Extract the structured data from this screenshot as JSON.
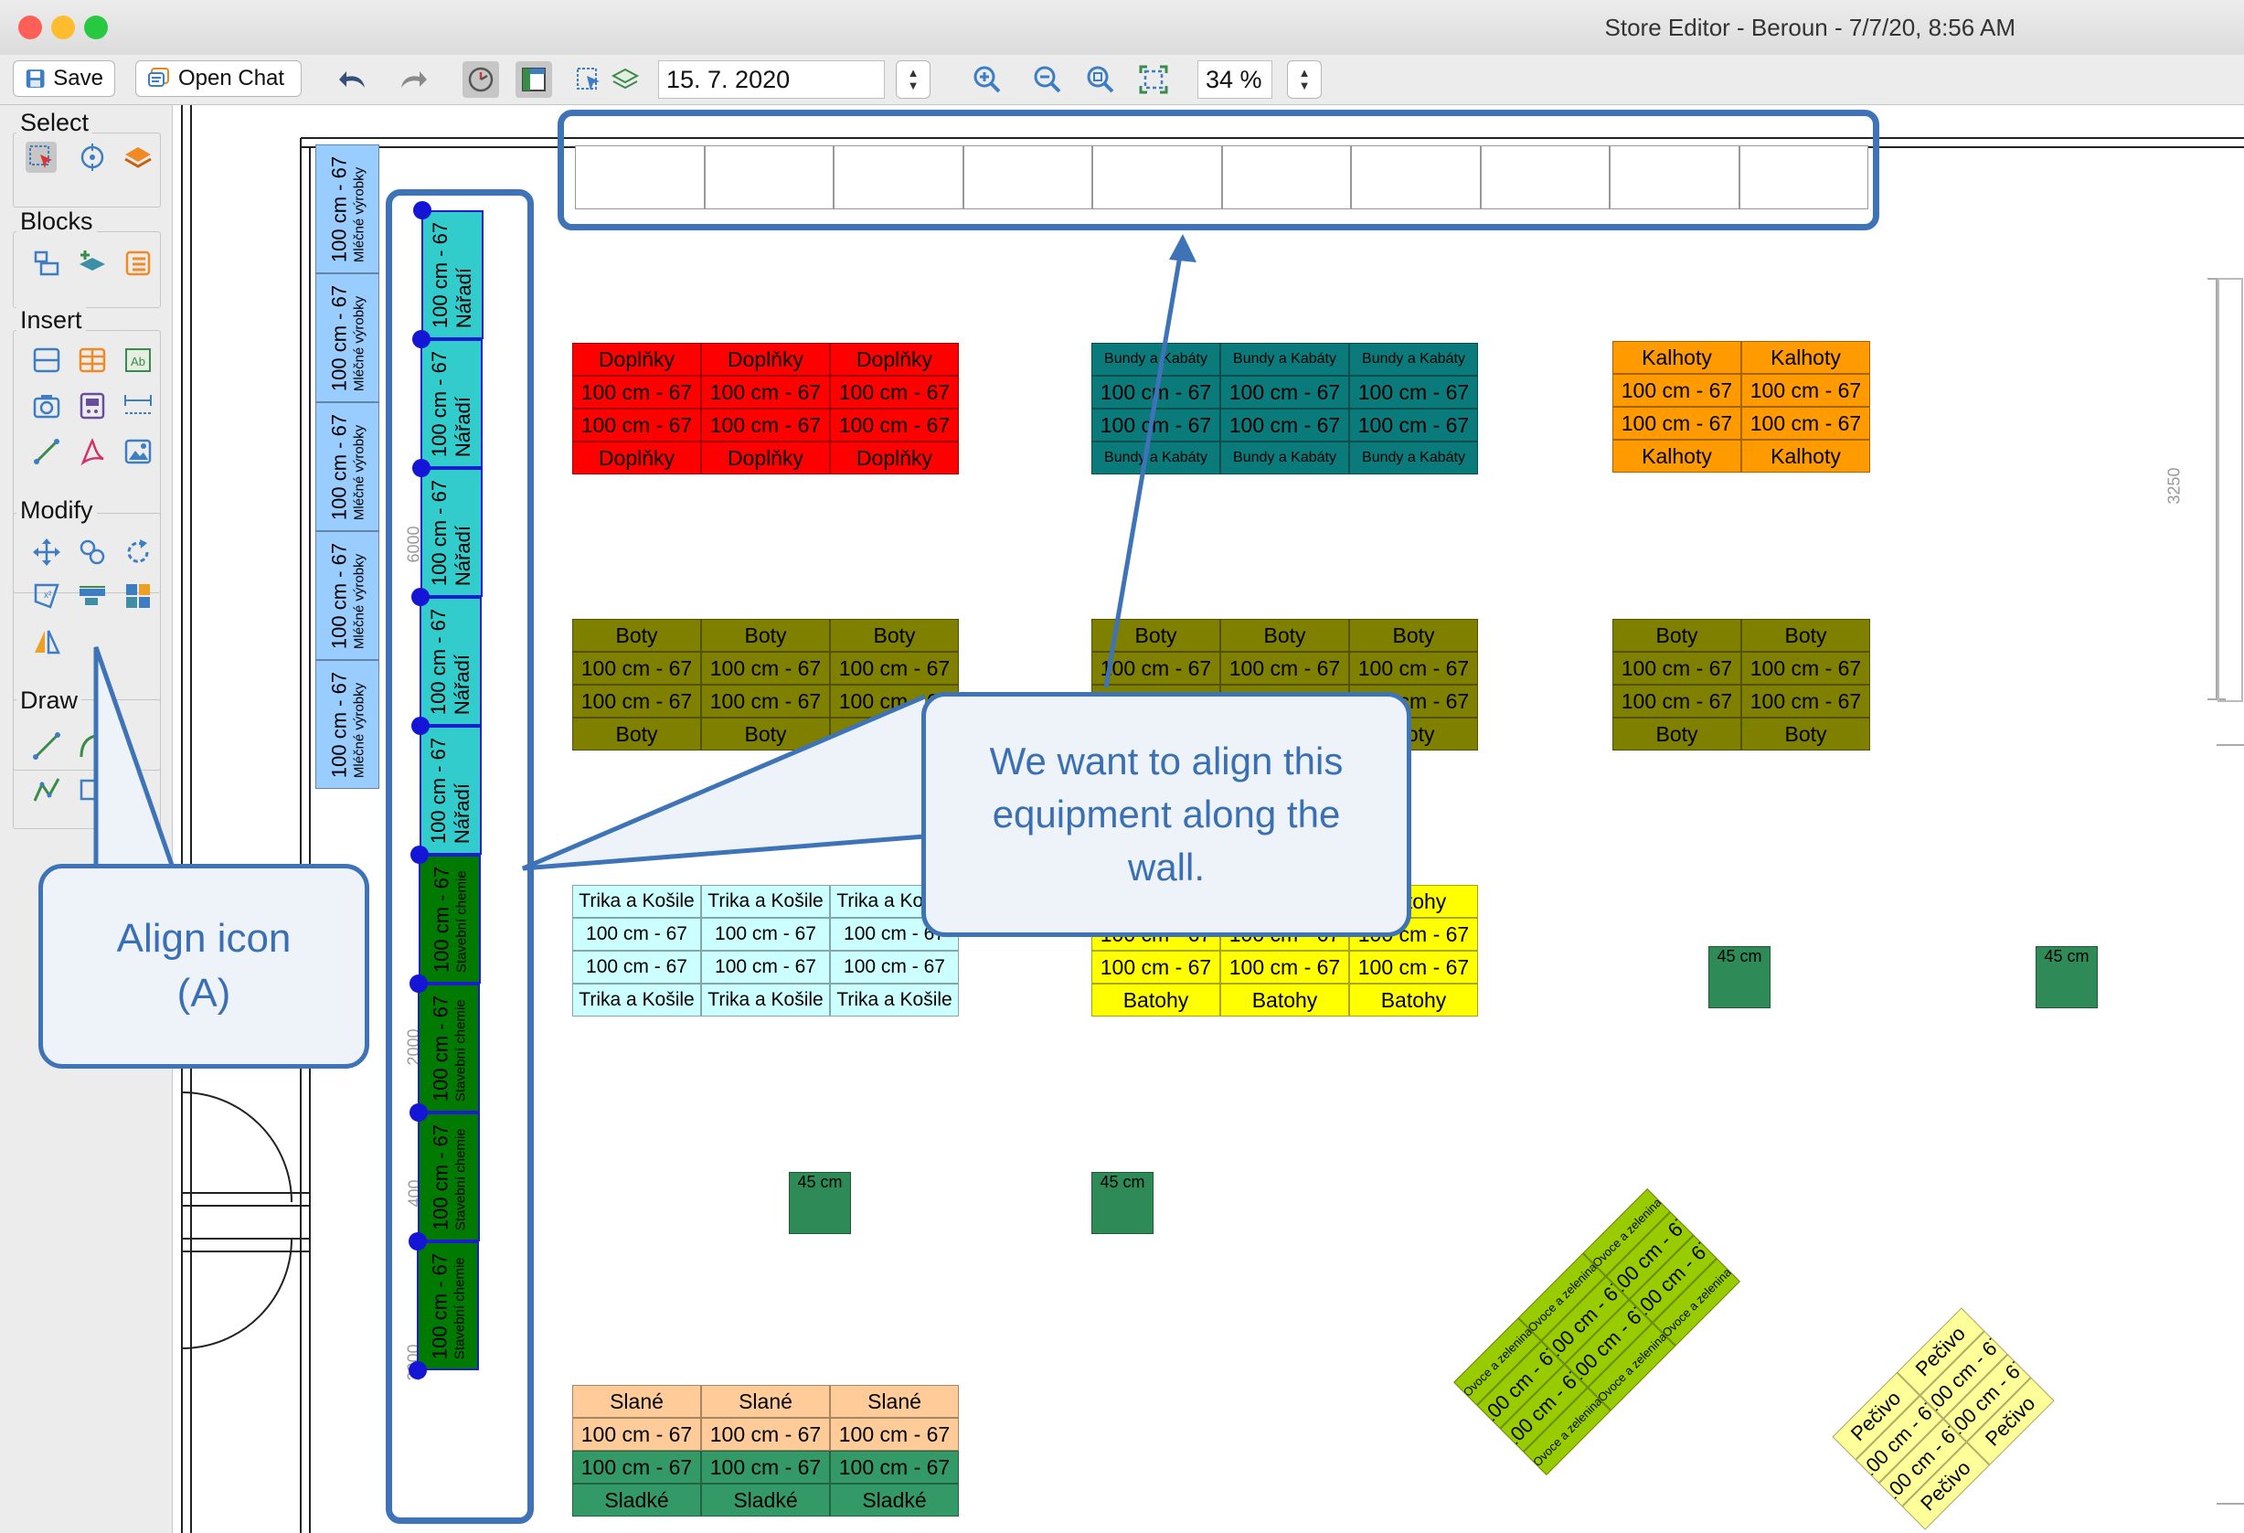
{
  "window": {
    "title": "Store Editor - Beroun - 7/7/20, 8:56 AM",
    "controls": {
      "close": "#fe5f57",
      "minimize": "#febc2e",
      "zoom": "#28c840"
    }
  },
  "toolbar": {
    "save_label": "Save",
    "open_chat_label": "Open Chat",
    "date_value": "15. 7. 2020",
    "zoom_value": "34 %",
    "icons": [
      "undo-icon",
      "redo-icon",
      "clock-icon",
      "floor-plan-icon",
      "select-layer-icon",
      "layers-icon",
      "zoom-in-icon",
      "zoom-out-icon",
      "zoom-reset-icon",
      "fit-icon"
    ]
  },
  "palette": {
    "select": {
      "title": "Select",
      "icons": [
        "rectangle-select-icon",
        "target-icon",
        "layers-select-icon"
      ]
    },
    "blocks": {
      "title": "Blocks",
      "icons": [
        "block-icon",
        "add-layer-icon",
        "block-list-icon"
      ]
    },
    "insert": {
      "title": "Insert",
      "icons": [
        "shelf-icon",
        "rack-icon",
        "text-icon",
        "camera-icon",
        "device-icon",
        "dimension-icon",
        "line-icon",
        "pdf-icon",
        "image-icon"
      ]
    },
    "modify": {
      "title": "Modify",
      "icons": [
        "move-icon",
        "copy-icon",
        "rotate-icon",
        "transform-icon",
        "align-icon",
        "grid-icon",
        "mirror-icon"
      ]
    },
    "draw": {
      "title": "Draw",
      "icons": [
        "draw-line-icon",
        "draw-arc-icon",
        "draw-polyline-icon",
        "draw-rect-icon"
      ]
    }
  },
  "colors": {
    "accent": "#3e73b7",
    "doplnky": "#ff0000",
    "bundy": "#0b7a7a",
    "kalhoty": "#ff9a00",
    "boty": "#7f7f00",
    "trika": "#ccffff",
    "batohy": "#ffff00",
    "zelena45": "#2e8b57",
    "slane": "#ffcc99",
    "sladke": "#339966",
    "ovoce": "#99cc00",
    "pecivo": "#ffff99",
    "naradi": "#33cccc",
    "chemie": "#007a00",
    "mlecne": "#99ccff"
  },
  "labels": {
    "size": "100 cm - 67",
    "small_size": "45 cm",
    "doplnky": "Doplňky",
    "bundy": "Bundy a Kabáty",
    "kalhoty": "Kalhoty",
    "boty": "Boty",
    "trika": "Trika a Košile",
    "batohy": "Batohy",
    "slane": "Slané",
    "sladke": "Sladké",
    "ovoce": "Ovoce a zelenina",
    "pecivo": "Pečivo",
    "naradi": "Nářadí",
    "chemie": "Stavební chemie",
    "mlecne": "Mléčné výrobky"
  },
  "rulers": [
    "6000",
    "2000",
    "400",
    "2000",
    "3250"
  ],
  "callouts": {
    "align": "Align icon (A)",
    "wall": "We want to align this equipment along the wall."
  }
}
